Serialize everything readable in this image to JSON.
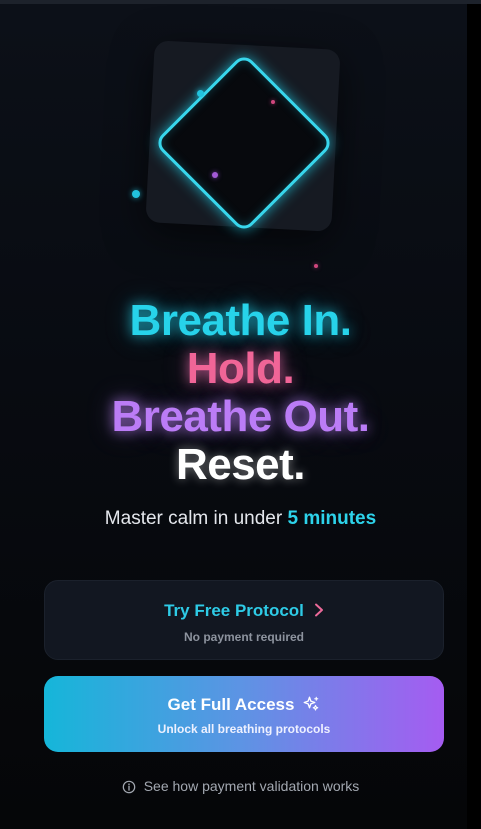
{
  "hero": {
    "line1": "Breathe In.",
    "line2": "Hold.",
    "line3": "Breathe Out.",
    "line4": "Reset."
  },
  "subtitle": {
    "prefix": "Master calm in under",
    "highlight": "5 minutes"
  },
  "free_button": {
    "label": "Try Free Protocol",
    "sublabel": "No payment required",
    "icon": "chevron-right-icon"
  },
  "full_button": {
    "label": "Get Full Access",
    "sublabel": "Unlock all breathing protocols",
    "icon": "sparkles-icon"
  },
  "info_link": {
    "label": "See how payment validation works",
    "icon": "info-icon"
  },
  "colors": {
    "cyan": "#22d3ee",
    "pink": "#f472b6",
    "purple": "#c084fc",
    "gradient_start": "#06b6d4",
    "gradient_end": "#a855f7",
    "background": "#080b11"
  }
}
